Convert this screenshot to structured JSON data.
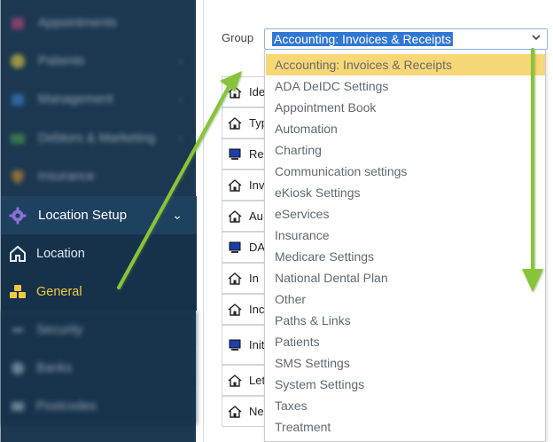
{
  "sidebar": {
    "blurred_items": [
      {
        "label": "Appointments",
        "icon": "calendar-icon",
        "color": "#c9467e"
      },
      {
        "label": "Patients",
        "icon": "smiley-icon",
        "color": "#f2d43a"
      },
      {
        "label": "Management",
        "icon": "chart-icon",
        "color": "#3c83d4"
      },
      {
        "label": "Debtors & Marketing",
        "icon": "money-icon",
        "color": "#4fa04c"
      },
      {
        "label": "Insurance",
        "icon": "shield-icon",
        "color": "#e0922d"
      }
    ],
    "section": {
      "label": "Location Setup",
      "icon": "gear-icon",
      "chevron": "chevron-down-icon"
    },
    "sub_items": [
      {
        "label": "Location",
        "icon": "house-icon"
      },
      {
        "label": "General",
        "icon": "cubes-icon"
      }
    ],
    "blurred_bottom_items": [
      {
        "label": "Security"
      },
      {
        "label": "Banks"
      },
      {
        "label": "Postcodes"
      }
    ]
  },
  "group": {
    "label": "Group",
    "selected_value": "Accounting: Invoices & Receipts"
  },
  "background_rows": [
    {
      "text": "Ide",
      "icon": "house-icon"
    },
    {
      "text": "Typ",
      "icon": "house-icon"
    },
    {
      "text": "Re",
      "icon": "computer-icon"
    },
    {
      "text": "Inv",
      "icon": "house-icon"
    },
    {
      "text": "Au",
      "icon": "house-icon"
    },
    {
      "text": "DA",
      "icon": "computer-icon"
    },
    {
      "text": "In",
      "icon": "house-icon"
    },
    {
      "text": "Inc",
      "icon": "house-icon"
    },
    {
      "text": "Init",
      "icon": "computer-icon"
    },
    {
      "text": "Let",
      "icon": "house-icon"
    },
    {
      "text": "Ne",
      "icon": "house-icon"
    }
  ],
  "dropdown_options": [
    "Accounting: Invoices & Receipts",
    "ADA DeIDC Settings",
    "Appointment Book",
    "Automation",
    "Charting",
    "Communication settings",
    "eKiosk Settings",
    "eServices",
    "Insurance",
    "Medicare Settings",
    "National Dental Plan",
    "Other",
    "Paths & Links",
    "Patients",
    "SMS Settings",
    "System Settings",
    "Taxes",
    "Treatment"
  ],
  "colors": {
    "sidebar_bg": "#1b3850",
    "active_text": "#f4c842",
    "selected_option": "#f8d776",
    "highlight": "#3277d1",
    "annotation_arrow": "#86c43a"
  }
}
